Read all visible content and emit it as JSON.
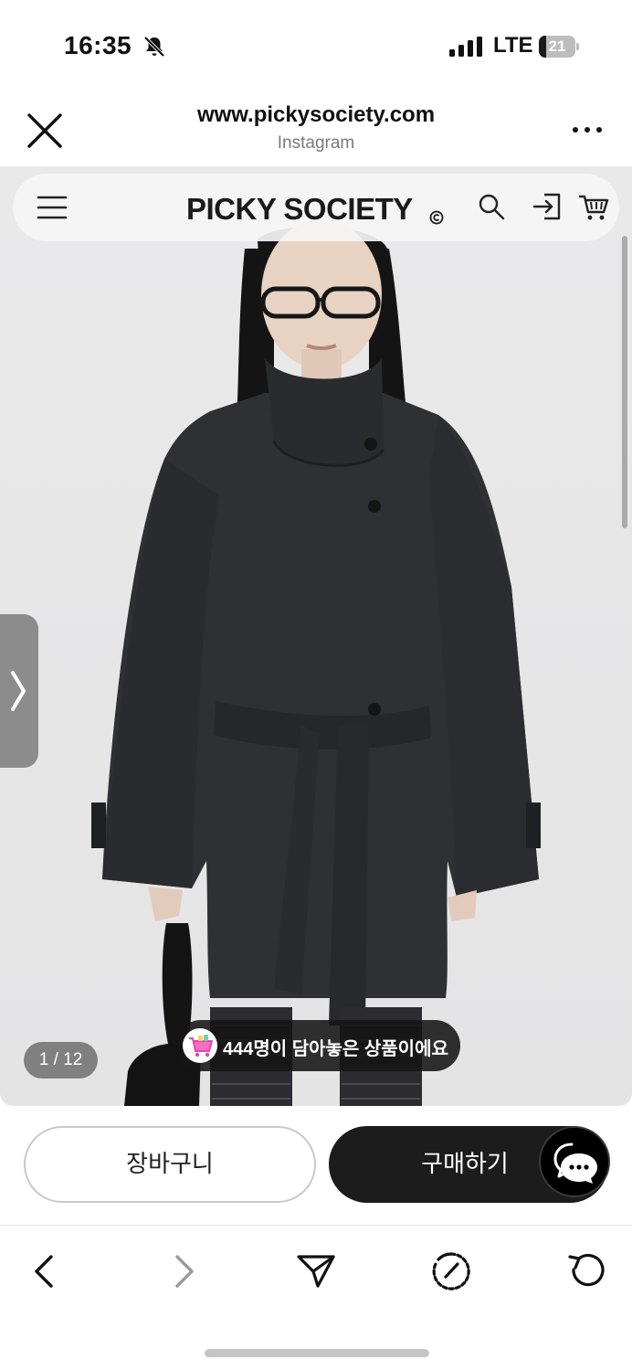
{
  "status_bar": {
    "time": "16:35",
    "network": "LTE",
    "battery_level": "21",
    "battery_fraction": 0.21
  },
  "browser": {
    "url": "www.pickysociety.com",
    "source": "Instagram"
  },
  "site": {
    "logo": "PICKY SOCIETY"
  },
  "gallery": {
    "page_counter": "1 / 12",
    "popular_text": "444명이 담아놓은 상품이에요"
  },
  "actions": {
    "cart_label": "장바구니",
    "buy_label": "구매하기"
  },
  "colors": {
    "buy_button": "#1c1c1c",
    "background": "#ebebeb",
    "coat": "#2f3034"
  }
}
